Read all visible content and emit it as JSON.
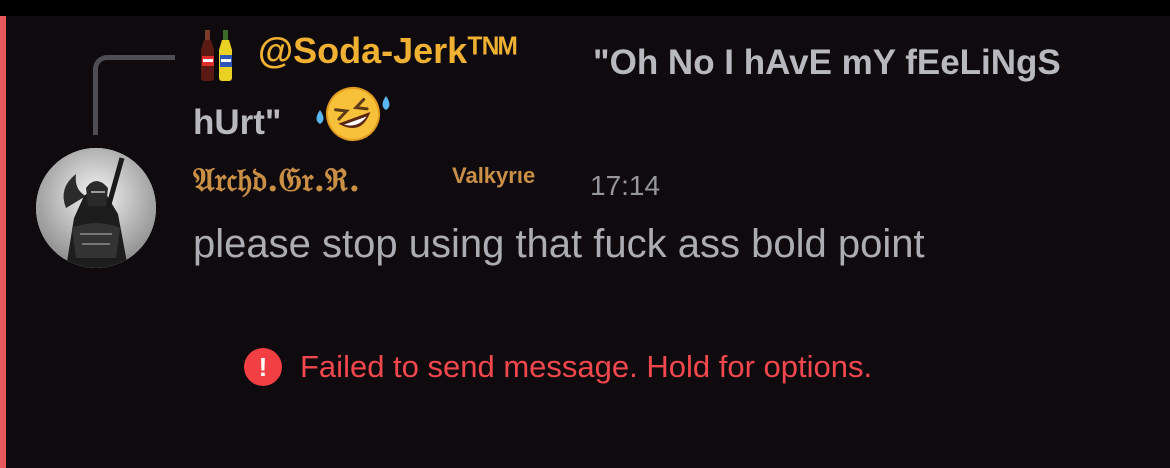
{
  "reply": {
    "author": "@Soda-Jerkᵀᴺᴹ",
    "text": "\"Oh No I hAvE mY fEeLiNgS hUrt\"",
    "author_emoji": "soda-bottles-icon",
    "reaction_emoji": "rolling-on-floor-laughing-icon"
  },
  "message": {
    "author": "𝔄𝔯𝔠𝔥𝔡.𝔊𝔯.ℜ.",
    "role": "Valkyrιe",
    "timestamp": "17:14",
    "text": "please stop using that fuck ass bold point"
  },
  "error": {
    "icon": "exclamation-icon",
    "text": "Failed to send message. Hold for options."
  },
  "colors": {
    "background": "#0f0a0e",
    "accent_bar": "#e8575c",
    "reply_author": "#f0b132",
    "message_author": "#c98f45",
    "error": "#f23f43"
  }
}
